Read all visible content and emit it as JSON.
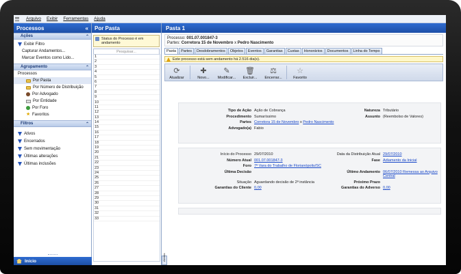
{
  "menu": [
    "Arquivo",
    "Exibir",
    "Ferramentas",
    "Ajuda"
  ],
  "left": {
    "title": "Processos",
    "collapse": "«",
    "acoes": {
      "header": "Ações",
      "items": [
        "Exibir Filtro",
        "Capturar Andamentos...",
        "Marcar Eventos como Lido..."
      ]
    },
    "agrupamento": {
      "header": "Agrupamento",
      "root": "Processos",
      "items": [
        "Por Pasta",
        "Por Número de Distribuição",
        "Por Advogado",
        "Por Entidade",
        "Por Foro",
        "Favoritos"
      ]
    },
    "filtros": {
      "header": "Filtros",
      "items": [
        "Ativos",
        "Encerrados",
        "Sem movimentação",
        "Últimas alterações",
        "Últimas inclusões"
      ]
    },
    "bottom": "Início"
  },
  "mid": {
    "title": "Por Pasta",
    "status": "Status do Processo é em andamento",
    "search_placeholder": "Pesquisar...",
    "numbers": [
      "1",
      "2",
      "3",
      "4",
      "5",
      "6",
      "7",
      "8",
      "9",
      "10",
      "11",
      "12",
      "13",
      "14",
      "15",
      "16",
      "17",
      "18",
      "19",
      "20",
      "21",
      "22",
      "23",
      "24",
      "25",
      "26",
      "27",
      "28",
      "29",
      "30",
      "31",
      "32",
      "33"
    ]
  },
  "right": {
    "title": "Pasta 1",
    "processo_label": "Processo:",
    "processo_num": "001.07.001847-3",
    "partes_label": "Partes:",
    "parte_a": "Corretora 15 de Novembro",
    "parte_x": "x",
    "parte_b": "Pedro Nascimento",
    "tabs": [
      "Pasta",
      "Partes",
      "Desdobramentos",
      "Objetos",
      "Eventos",
      "Garantias",
      "Custas",
      "Honorários",
      "Documentos",
      "Linha do Tempo"
    ],
    "warning": "Este processo está sem andamento há 2.516 dia(s).",
    "toolbar": [
      "Atualizar",
      "Novo...",
      "Modificar...",
      "Excluir...",
      "Encerrar...",
      "Favorito"
    ],
    "vertical_tab": "Alertas",
    "card1": {
      "tipo_acao_lbl": "Tipo de Ação",
      "tipo_acao": "Ação de Cobrança",
      "natureza_lbl": "Natureza",
      "natureza": "Tributário",
      "procedimento_lbl": "Procedimento",
      "procedimento": "Sumaríssimo",
      "assunto_lbl": "Assunto",
      "assunto": "(Reembolso de Valores)",
      "partes_lbl": "Partes",
      "partes_a": "Corretora 15 de Novembro",
      "partes_x": "x",
      "partes_b": "Pedro Nascimento",
      "advogado_lbl": "Advogado(a)",
      "advogado": "Fabio"
    },
    "card2": {
      "inicio_lbl": "Início do Processo",
      "inicio": "29/07/2010",
      "dist_lbl": "Data da Distribuição Atual",
      "dist": "29/07/2010",
      "numero_lbl": "Número Atual",
      "numero": "001.07.001847-3",
      "fase_lbl": "Fase",
      "fase": "Adiamento da Inicial",
      "foro_lbl": "Foro",
      "foro": "7ª Vara do Trabalho de Florianópolis/SC",
      "ultima_decisao_lbl": "Última Decisão",
      "ultima_decisao": "",
      "ultimo_and_lbl": "Último Andamento",
      "ultimo_and": "06/07/2010 Remessa ao Arquivo Central",
      "situacao_lbl": "Situação",
      "situacao": "Aguardando decisão de 2ª instância",
      "prazo_lbl": "Próximo Prazo",
      "prazo": "",
      "gar_cliente_lbl": "Garantias do Cliente",
      "gar_cliente": "0,00",
      "gar_adverso_lbl": "Garantias do Adverso",
      "gar_adverso": "0,00"
    }
  }
}
